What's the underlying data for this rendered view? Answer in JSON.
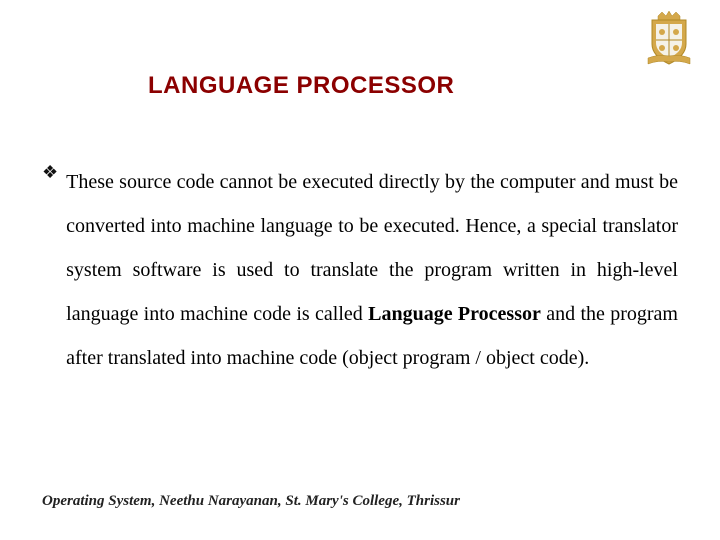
{
  "title": "LANGUAGE PROCESSOR",
  "bullet": {
    "part1": "These source code cannot be executed directly by the computer and must be converted into machine language to be executed. Hence, a special translator system software is used to translate the program written in high-level language into machine code is called ",
    "bold1": "Language Processor",
    "part2": " and the program after translated into machine code (object program / object code)."
  },
  "footer": "Operating System, Neethu Narayanan, St. Mary's College, Thrissur",
  "icons": {
    "crest": "college-crest-icon",
    "bullet": "diamond-bullet-icon"
  }
}
